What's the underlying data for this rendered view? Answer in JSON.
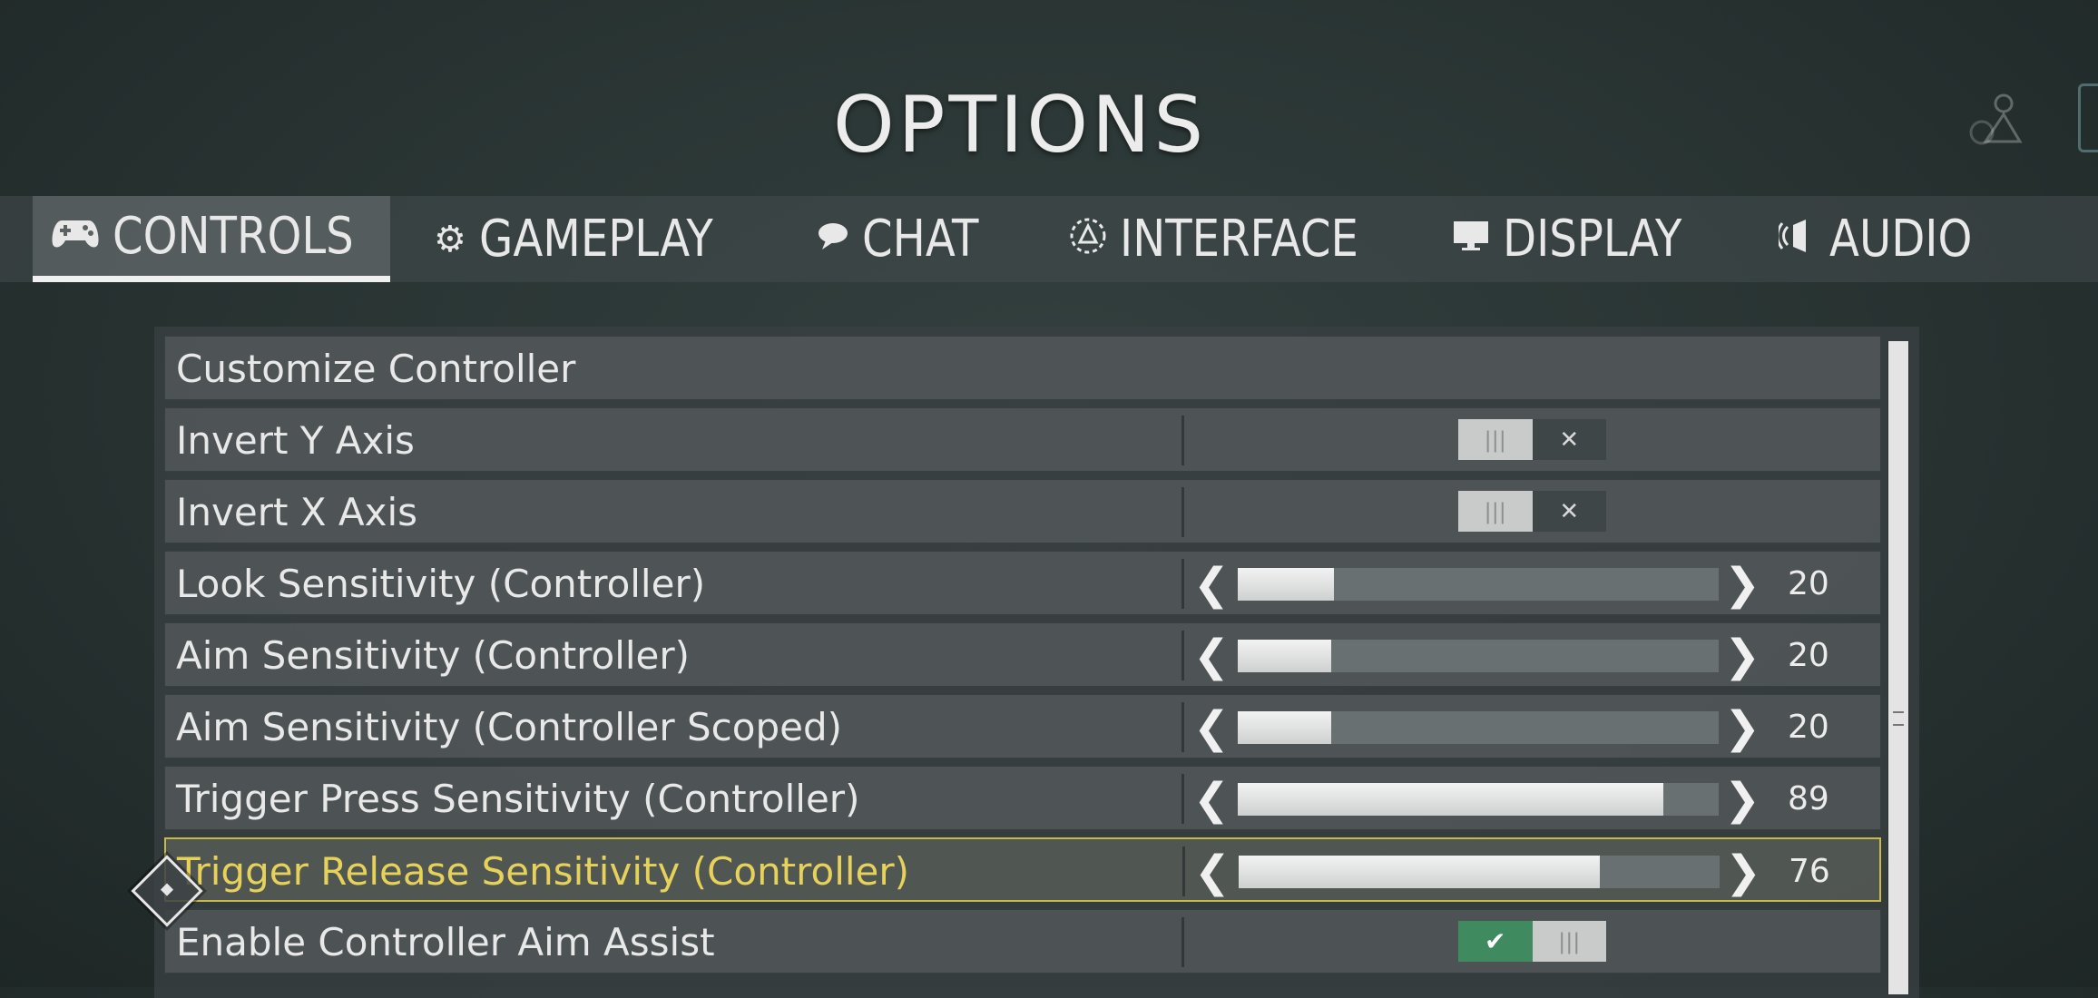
{
  "header": {
    "title": "OPTIONS"
  },
  "tabs": [
    {
      "label": "CONTROLS",
      "icon": "gamepad-icon",
      "glyph": "🎮",
      "active": true
    },
    {
      "label": "GAMEPLAY",
      "icon": "gear-icon",
      "glyph": "⚙",
      "active": false
    },
    {
      "label": "CHAT",
      "icon": "chat-bubble-icon",
      "glyph": "●",
      "active": false
    },
    {
      "label": "INTERFACE",
      "icon": "interface-icon",
      "glyph": "◬",
      "active": false
    },
    {
      "label": "DISPLAY",
      "icon": "monitor-icon",
      "glyph": "▬",
      "active": false
    },
    {
      "label": "AUDIO",
      "icon": "speaker-icon",
      "glyph": "◖",
      "active": false
    }
  ],
  "settings": [
    {
      "label": "Customize Controller",
      "type": "link"
    },
    {
      "label": "Invert Y Axis",
      "type": "toggle",
      "on": false,
      "off_glyph": "✕",
      "knob_glyph": "|||"
    },
    {
      "label": "Invert X Axis",
      "type": "toggle",
      "on": false,
      "off_glyph": "✕",
      "knob_glyph": "|||"
    },
    {
      "label": "Look Sensitivity (Controller)",
      "type": "slider",
      "value": "20",
      "fraction": 0.2
    },
    {
      "label": "Aim Sensitivity (Controller)",
      "type": "slider",
      "value": "20",
      "fraction": 0.195
    },
    {
      "label": "Aim Sensitivity (Controller Scoped)",
      "type": "slider",
      "value": "20",
      "fraction": 0.195
    },
    {
      "label": "Trigger Press Sensitivity (Controller)",
      "type": "slider",
      "value": "89",
      "fraction": 0.885
    },
    {
      "label": "Trigger Release Sensitivity (Controller)",
      "type": "slider",
      "value": "76",
      "fraction": 0.75,
      "selected": true
    },
    {
      "label": "Enable Controller Aim Assist",
      "type": "toggle",
      "on": true,
      "on_glyph": "✔",
      "knob_glyph": "|||"
    }
  ],
  "arrows": {
    "left": "❮",
    "right": "❯"
  },
  "colors": {
    "selected_border": "#c9b84a",
    "selected_text": "#e6d15a",
    "toggle_on": "#3f8a5e"
  }
}
